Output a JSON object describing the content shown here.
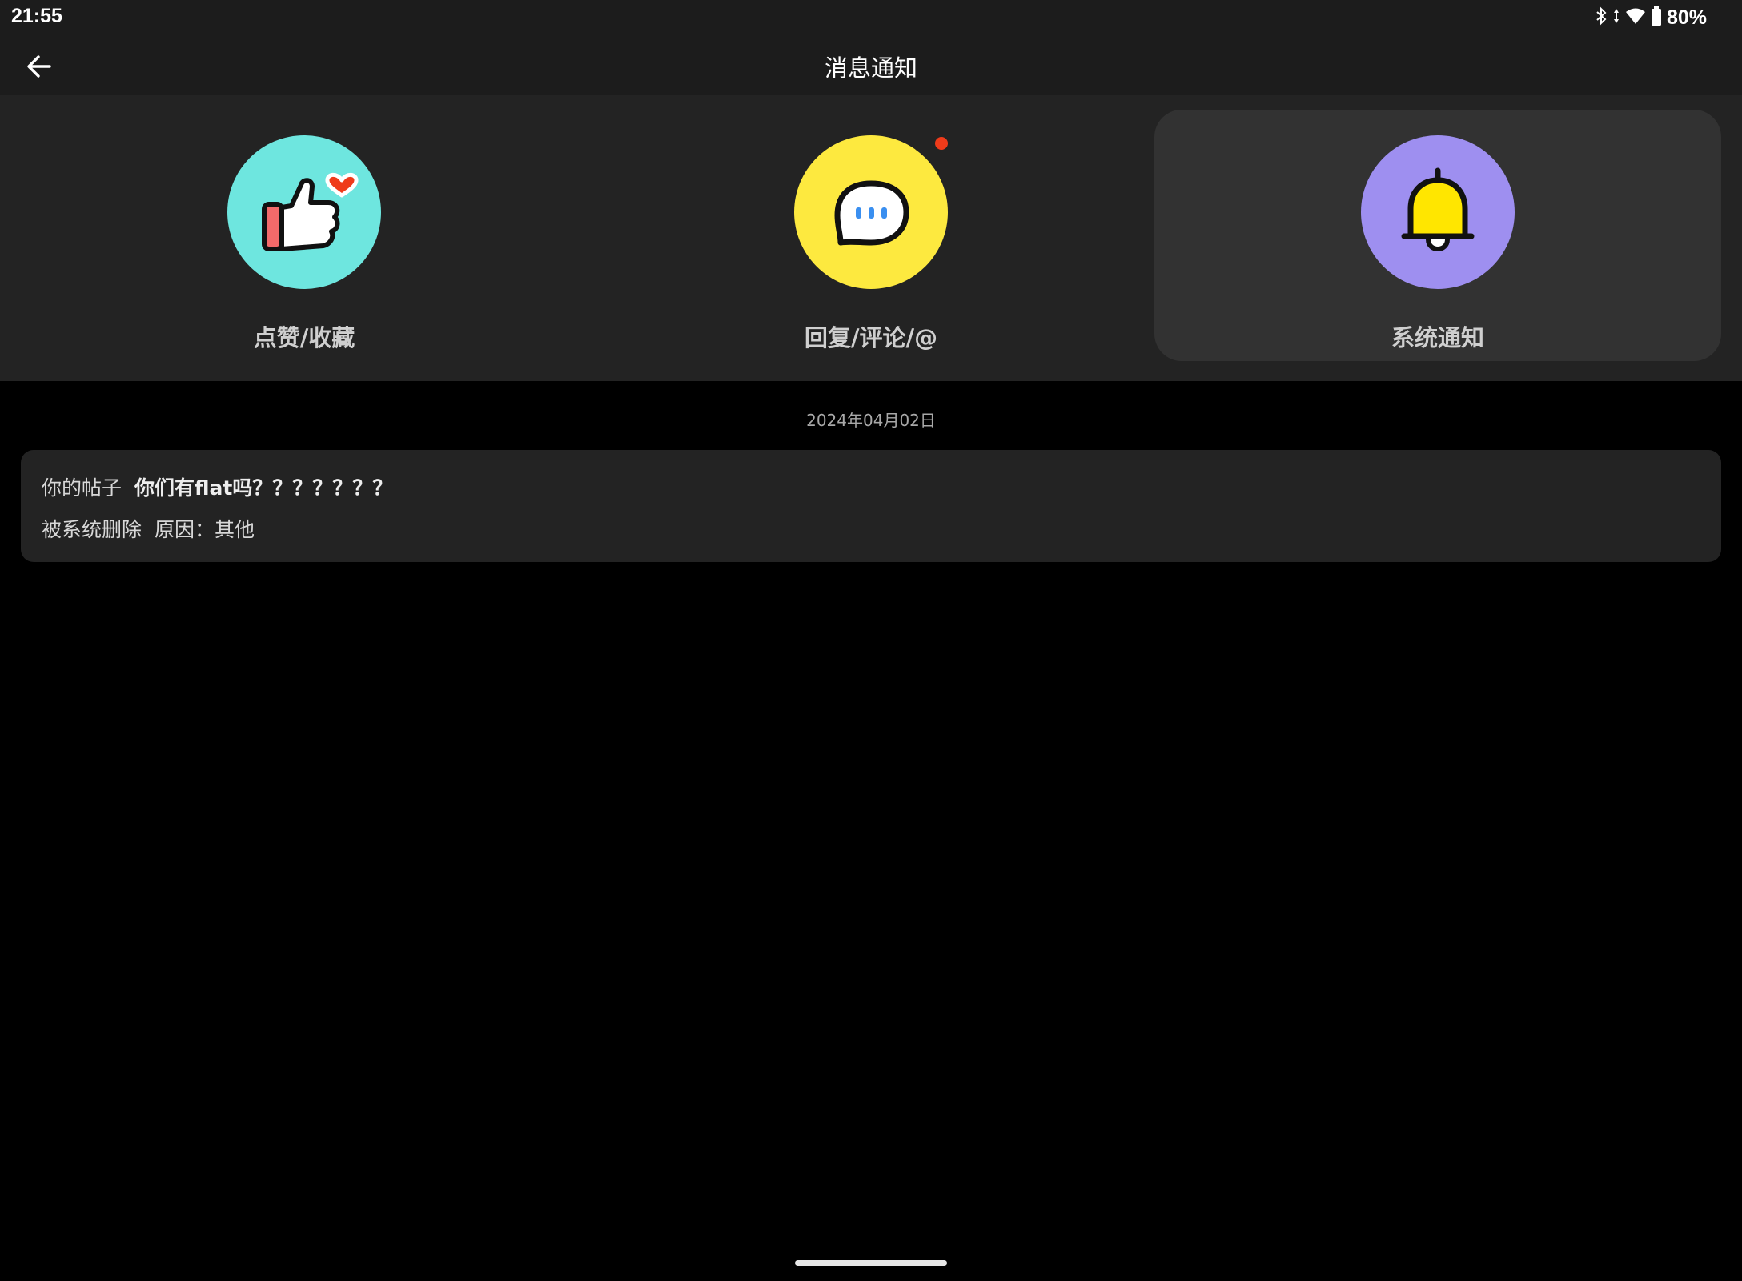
{
  "status_bar": {
    "time": "21:55",
    "battery": "80%",
    "icons": [
      "bluetooth-icon",
      "data-arrows-icon",
      "wifi-icon",
      "battery-icon"
    ]
  },
  "header": {
    "title": "消息通知",
    "back_icon": "arrow-left-icon"
  },
  "categories": [
    {
      "label": "点赞/收藏",
      "icon": "thumbs-up-heart-icon",
      "color": "#6ee6df",
      "active": false,
      "unread": false
    },
    {
      "label": "回复/评论/@",
      "icon": "speech-bubble-icon",
      "color": "#fde93f",
      "active": false,
      "unread": true
    },
    {
      "label": "系统通知",
      "icon": "bell-icon",
      "color": "#9e8ff0",
      "active": true,
      "unread": false
    }
  ],
  "feed": {
    "date": "2024年04月02日",
    "messages": [
      {
        "prefix": "你的帖子",
        "post_title": "你们有flat吗？？？？？？？",
        "action": "被系统删除",
        "reason": "原因：其他"
      }
    ]
  },
  "colors": {
    "background": "#000000",
    "bar": "#1c1c1c",
    "panel": "#232323",
    "active_tab": "#323232",
    "unread_dot": "#ef3b1a"
  }
}
